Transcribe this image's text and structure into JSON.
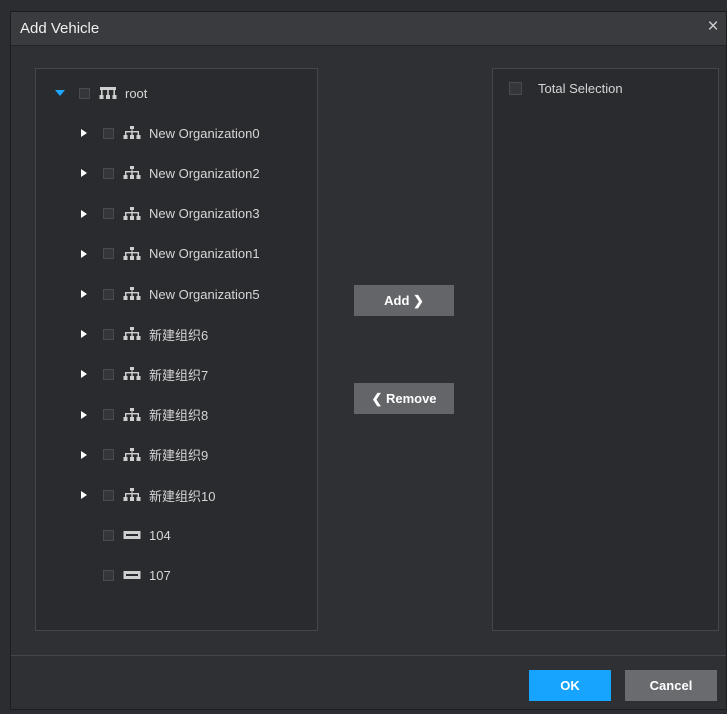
{
  "dialog": {
    "title": "Add Vehicle",
    "close_glyph": "×"
  },
  "tree": {
    "rows": [
      {
        "label": "root",
        "arrow": "down",
        "icon": "root-org-icon",
        "depth": 0
      },
      {
        "label": "New Organization0",
        "arrow": "right",
        "icon": "org-icon",
        "depth": 1
      },
      {
        "label": "New Organization2",
        "arrow": "right",
        "icon": "org-icon",
        "depth": 1
      },
      {
        "label": "New Organization3",
        "arrow": "right",
        "icon": "org-icon",
        "depth": 1
      },
      {
        "label": "New Organization1",
        "arrow": "right",
        "icon": "org-icon",
        "depth": 1
      },
      {
        "label": "New Organization5",
        "arrow": "right",
        "icon": "org-icon",
        "depth": 1
      },
      {
        "label": "新建组织6",
        "arrow": "right",
        "icon": "org-icon",
        "depth": 1
      },
      {
        "label": "新建组织7",
        "arrow": "right",
        "icon": "org-icon",
        "depth": 1
      },
      {
        "label": "新建组织8",
        "arrow": "right",
        "icon": "org-icon",
        "depth": 1
      },
      {
        "label": "新建组织9",
        "arrow": "right",
        "icon": "org-icon",
        "depth": 1
      },
      {
        "label": "新建组织10",
        "arrow": "right",
        "icon": "org-icon",
        "depth": 1
      },
      {
        "label": "104",
        "arrow": "none",
        "icon": "vehicle-icon",
        "depth": 1
      },
      {
        "label": "107",
        "arrow": "none",
        "icon": "vehicle-icon",
        "depth": 1
      }
    ]
  },
  "actions": {
    "add_label": "Add ❯",
    "remove_label": "❮ Remove"
  },
  "selection": {
    "total_label": "Total Selection"
  },
  "footer": {
    "ok_label": "OK",
    "cancel_label": "Cancel"
  },
  "colors": {
    "accent": "#17a4ff",
    "expand_arrow": "#1ea7ff"
  }
}
